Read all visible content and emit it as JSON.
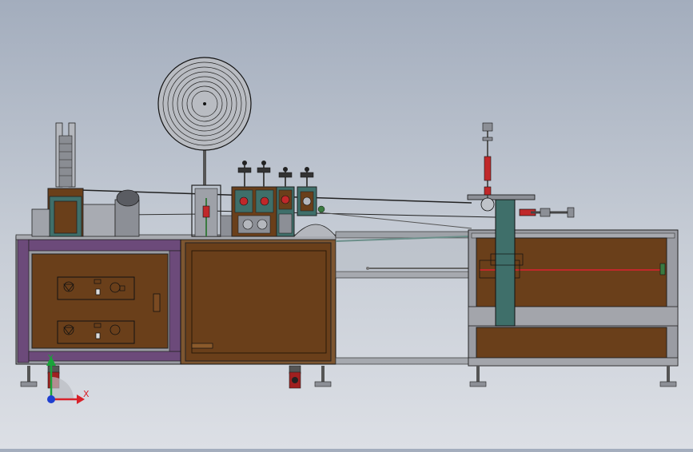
{
  "viewport": {
    "background_top": "#a3adbd",
    "background_bottom": "#dcdfe5"
  },
  "colors": {
    "frame": "#8c8f96",
    "frame_purple": "#6c4a7a",
    "panel_brown": "#6a3f1a",
    "panel_brown_dark": "#4e2d10",
    "accent_red": "#c0282a",
    "accent_teal": "#3f6f6a",
    "axis_x": "#d8222a",
    "axis_y": "#1aa33a",
    "axis_z": "#1f3fd0"
  },
  "triad": {
    "x_label": "X",
    "y_label": "Y"
  }
}
